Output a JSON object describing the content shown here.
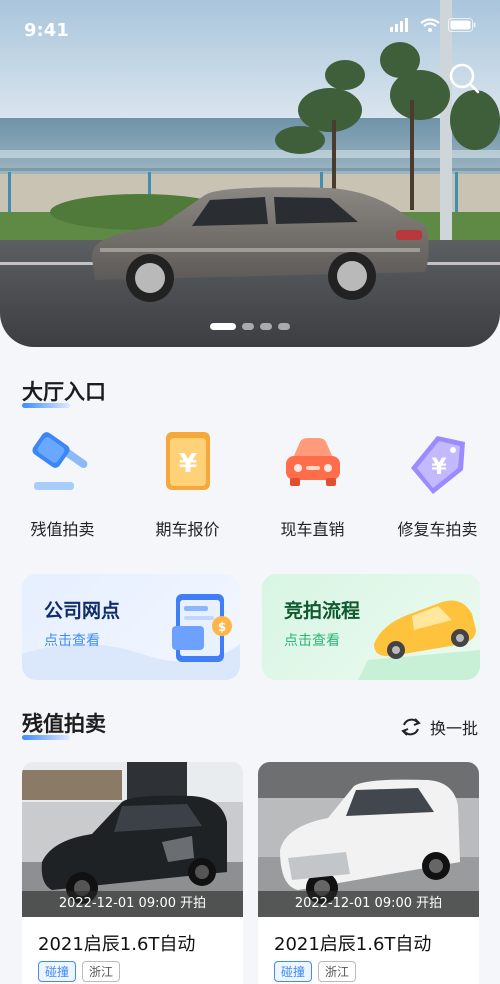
{
  "status_bar": {
    "time": "9:41"
  },
  "hero": {
    "slides": 4,
    "active_slide": 1
  },
  "hall": {
    "title": "大厅入口",
    "items": [
      {
        "label": "残值拍卖",
        "icon": "gavel-icon"
      },
      {
        "label": "期车报价",
        "icon": "yuan-document-icon"
      },
      {
        "label": "现车直销",
        "icon": "car-icon"
      },
      {
        "label": "修复车拍卖",
        "icon": "yuan-tag-icon"
      }
    ]
  },
  "promo_cards": [
    {
      "title": "公司网点",
      "subtitle": "点击查看",
      "color": "#3d8bff"
    },
    {
      "title": "竞拍流程",
      "subtitle": "点击查看",
      "color": "#2bb673"
    }
  ],
  "auction": {
    "title": "残值拍卖",
    "refresh_label": "换一批",
    "cars": [
      {
        "time": "2022-12-01 09:00 开拍",
        "name": "2021启辰1.6T自动",
        "tags": [
          "碰撞",
          "浙江"
        ]
      },
      {
        "time": "2022-12-01 09:00 开拍",
        "name": "2021启辰1.6T自动",
        "tags": [
          "碰撞",
          "浙江"
        ]
      }
    ]
  }
}
